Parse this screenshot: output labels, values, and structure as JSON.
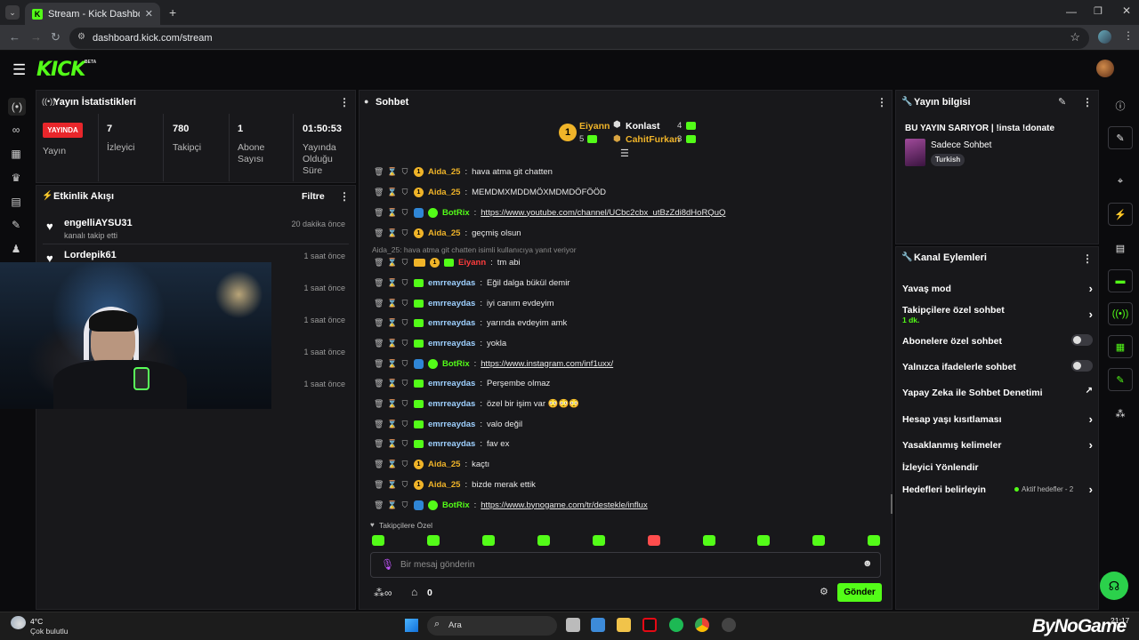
{
  "browser": {
    "tab_title": "Stream - Kick Dashboard",
    "url": "dashboard.kick.com/stream"
  },
  "header": {
    "logo": "KICK",
    "beta": "BETA"
  },
  "stats": {
    "title": "Yayın İstatistikleri",
    "live_badge": "YAYINDA",
    "live_label": "Yayın",
    "viewers_value": "7",
    "viewers_label": "İzleyici",
    "followers_value": "780",
    "followers_label": "Takipçi",
    "subs_value": "1",
    "subs_label": "Abone Sayısı",
    "duration_value": "01:50:53",
    "duration_label": "Yayında Olduğu Süre"
  },
  "activity": {
    "title": "Etkinlik Akışı",
    "filter": "Filtre",
    "items": [
      {
        "name": "engelliAYSU31",
        "sub": "kanalı takip etti",
        "time": "20 dakika önce"
      },
      {
        "name": "Lordepik61",
        "sub": "",
        "time": "1 saat önce"
      },
      {
        "name": "",
        "sub": "",
        "time": "1 saat önce"
      },
      {
        "name": "",
        "sub": "",
        "time": "1 saat önce"
      },
      {
        "name": "",
        "sub": "",
        "time": "1 saat önce"
      },
      {
        "name": "",
        "sub": "",
        "time": "1 saat önce"
      }
    ]
  },
  "chat": {
    "title": "Sohbet",
    "leaderboard": {
      "first_name": "Eiyann",
      "first_count": "5",
      "second_label": "Konlast",
      "second_count": "4",
      "third_name": "CahitFurkan",
      "third_count": "3"
    },
    "reply_note": "Aida_25: hava atma git chatten isimli kullanıcıya yanıt veriyor",
    "messages": [
      {
        "user": "Aida_25",
        "text": "hava atma git chatten",
        "color": "orange",
        "badges": [
          "orange"
        ]
      },
      {
        "user": "Aida_25",
        "text": "MEMDMXMDDMÖXMDMDÖFÖÖD",
        "color": "orange",
        "badges": [
          "orange"
        ]
      },
      {
        "user": "BotRix",
        "text": "https://www.youtube.com/channel/UCbc2cbx_utBzZdi8dHoRQuQ",
        "color": "green",
        "badges": [
          "blue",
          "vg"
        ],
        "link": true
      },
      {
        "user": "Aida_25",
        "text": "geçmiş olsun",
        "color": "orange",
        "badges": [
          "orange"
        ]
      },
      {
        "user": "Eiyann",
        "text": "tm abi",
        "color": "red",
        "badges": [
          "crown",
          "orange",
          "green"
        ]
      },
      {
        "user": "emrreaydas",
        "text": "Eğil dalga bükül demir",
        "color": "blue",
        "badges": [
          "green"
        ]
      },
      {
        "user": "emrreaydas",
        "text": "iyi canım evdeyim",
        "color": "blue",
        "badges": [
          "green"
        ]
      },
      {
        "user": "emrreaydas",
        "text": "yarında evdeyim amk",
        "color": "blue",
        "badges": [
          "green"
        ]
      },
      {
        "user": "emrreaydas",
        "text": "yokla",
        "color": "blue",
        "badges": [
          "green"
        ]
      },
      {
        "user": "BotRix",
        "text": "https://www.instagram.com/inf1uxx/",
        "color": "green",
        "badges": [
          "blue",
          "vg"
        ],
        "link": true
      },
      {
        "user": "emrreaydas",
        "text": "Perşembe olmaz",
        "color": "blue",
        "badges": [
          "green"
        ]
      },
      {
        "user": "emrreaydas",
        "text": "özel bir işim var 😳😳😳",
        "color": "blue",
        "badges": [
          "green"
        ]
      },
      {
        "user": "emrreaydas",
        "text": "valo değil",
        "color": "blue",
        "badges": [
          "green"
        ]
      },
      {
        "user": "emrreaydas",
        "text": "fav ex",
        "color": "blue",
        "badges": [
          "green"
        ]
      },
      {
        "user": "Aida_25",
        "text": "kaçtı",
        "color": "orange",
        "badges": [
          "orange"
        ]
      },
      {
        "user": "Aida_25",
        "text": "bizde merak ettik",
        "color": "orange",
        "badges": [
          "orange"
        ]
      },
      {
        "user": "BotRix",
        "text": "https://www.bynogame.com/tr/destekle/influx",
        "color": "green",
        "badges": [
          "blue",
          "vg"
        ],
        "link": true
      }
    ],
    "followers_only_label": "Takipçilere Özel",
    "input_placeholder": "Bir mesaj gönderin",
    "points": "0",
    "send": "Gönder"
  },
  "stream_info": {
    "title": "Yayın bilgisi",
    "stream_title": "BU YAYIN SARIYOR | !insta !donate",
    "category": "Sadece Sohbet",
    "language": "Turkish"
  },
  "channel_actions": {
    "title": "Kanal Eylemleri",
    "slow_mode": "Yavaş mod",
    "followers_chat": "Takipçilere özel sohbet",
    "followers_chat_sub": "1 dk.",
    "subs_chat": "Abonelere özel sohbet",
    "emotes_chat": "Yalnızca ifadelerle sohbet",
    "ai_moderation": "Yapay Zeka ile Sohbet Denetimi",
    "age_restriction": "Hesap yaşı kısıtlaması",
    "banned_words": "Yasaklanmış kelimeler",
    "redirect": "İzleyici Yönlendir",
    "goals": "Hedefleri belirleyin",
    "goals_status": "Aktif hedefler - 2"
  },
  "taskbar": {
    "temp": "4°C",
    "weather": "Çok bulutlu",
    "search": "Ara",
    "watermark": "ByNoGame",
    "time": "21:17"
  },
  "colors": {
    "accent": "#53fc18",
    "live": "#e8262b",
    "panel": "#18181b"
  }
}
